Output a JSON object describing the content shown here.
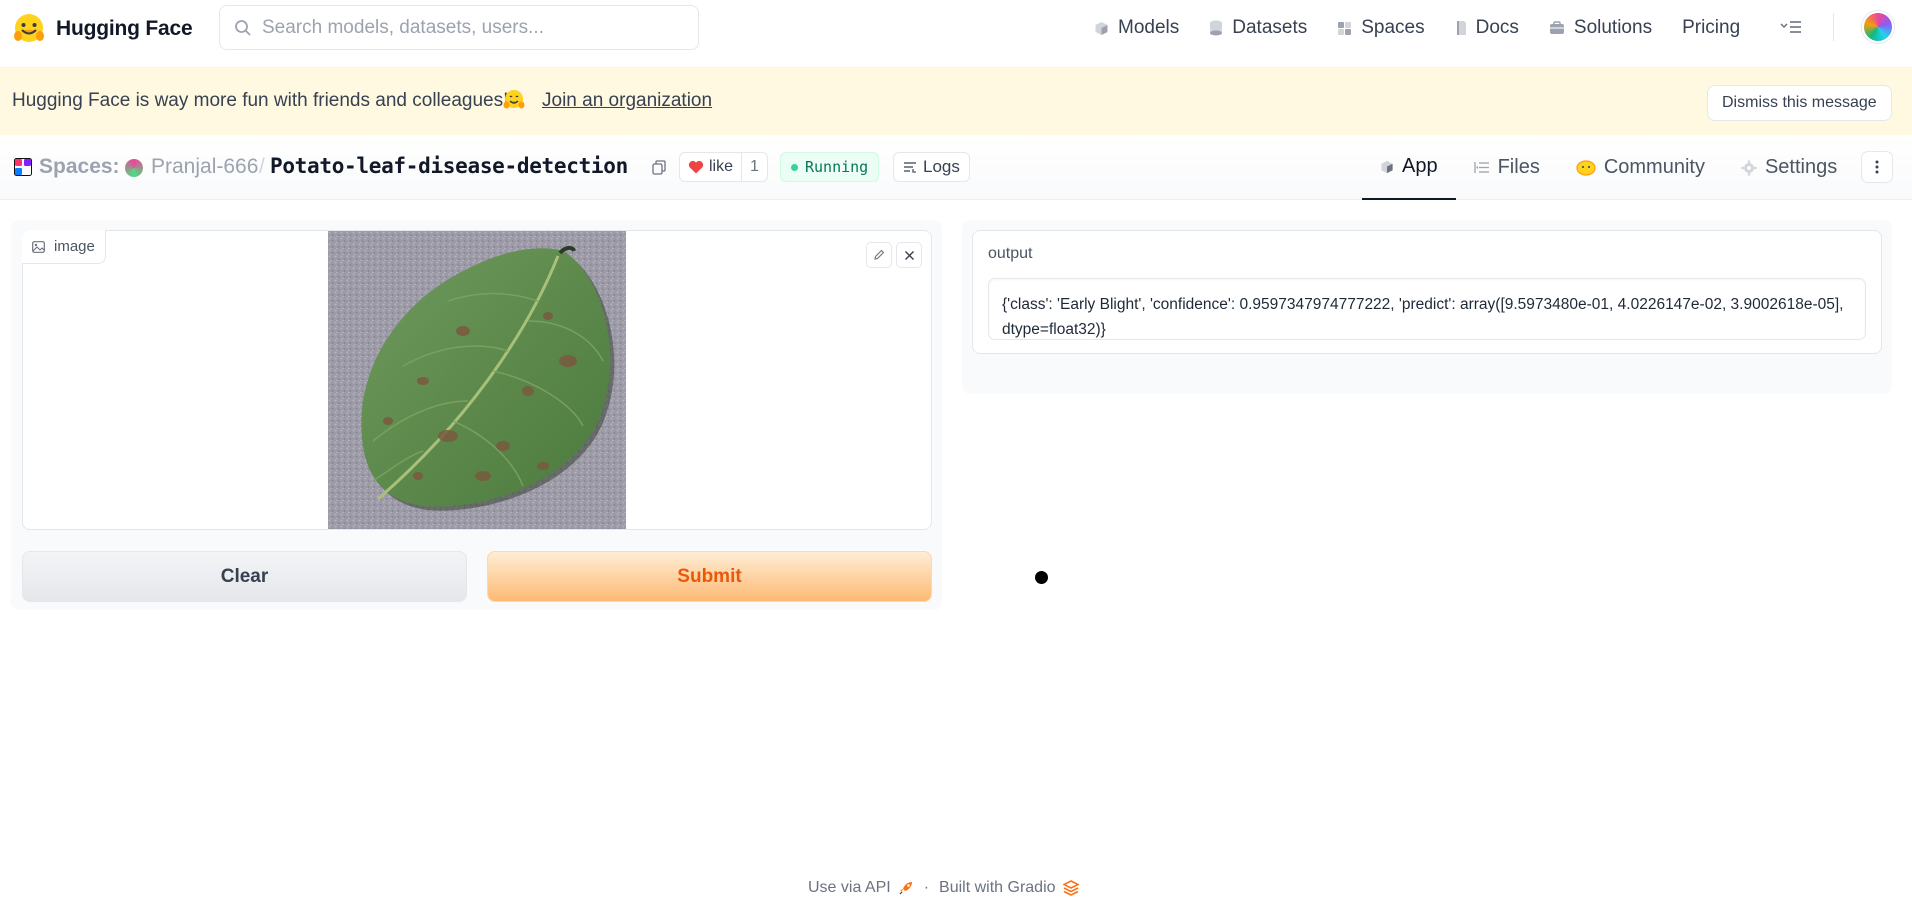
{
  "nav": {
    "brand": "Hugging Face",
    "search_placeholder": "Search models, datasets, users...",
    "links": [
      {
        "label": "Models",
        "icon": "cube-icon"
      },
      {
        "label": "Datasets",
        "icon": "database-icon"
      },
      {
        "label": "Spaces",
        "icon": "spaces-grid-icon"
      },
      {
        "label": "Docs",
        "icon": "docs-icon"
      },
      {
        "label": "Solutions",
        "icon": "briefcase-icon"
      },
      {
        "label": "Pricing",
        "icon": ""
      }
    ]
  },
  "banner": {
    "text": "Hugging Face is way more fun with friends and colleagues!",
    "emoji": "🤗",
    "link": "Join an organization",
    "dismiss": "Dismiss this message"
  },
  "space": {
    "label": "Spaces:",
    "owner": "Pranjal-666",
    "separator": "/",
    "name": "Potato-leaf-disease-detection",
    "like_label": "like",
    "like_count": "1",
    "status": "Running",
    "logs": "Logs",
    "tabs": [
      {
        "label": "App",
        "icon": "cube-icon",
        "active": true
      },
      {
        "label": "Files",
        "icon": "files-icon",
        "active": false
      },
      {
        "label": "Community",
        "icon": "community-icon",
        "active": false
      },
      {
        "label": "Settings",
        "icon": "gear-icon",
        "active": false
      }
    ]
  },
  "app": {
    "image_label": "image",
    "clear": "Clear",
    "submit": "Submit",
    "output_label": "output",
    "output_text": "{'class': 'Early Blight', 'confidence': 0.9597347974777222, 'predict': array([9.5973480e-01, 4.0226147e-02, 3.9002618e-05], dtype=float32)}"
  },
  "footer": {
    "api": "Use via API",
    "separator": "·",
    "built": "Built with Gradio"
  },
  "colors": {
    "banner_bg": "#fef9e0",
    "submit_text": "#ea580c",
    "status_green": "#047857"
  }
}
